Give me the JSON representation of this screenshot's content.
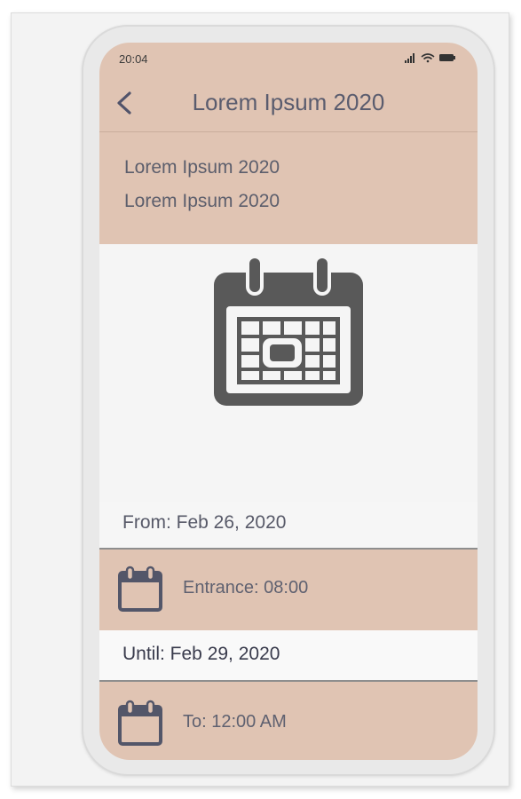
{
  "status_bar": {
    "time": "20:04",
    "icons": [
      "signal-icon",
      "wifi-icon",
      "battery-icon"
    ]
  },
  "header": {
    "back_icon": "chevron-left-icon",
    "title": "Lorem Ipsum 2020"
  },
  "info": {
    "line1": "Lorem Ipsum 2020",
    "line2": "Lorem Ipsum 2020"
  },
  "hero": {
    "icon": "calendar-icon"
  },
  "schedule": {
    "from_label": "From: Feb 26, 2020",
    "entrance_label": "Entrance: 08:00",
    "until_label": "Until: Feb 29, 2020",
    "to_label": "To: 12:00 AM",
    "row_icon": "calendar-icon"
  },
  "colors": {
    "accent_background": "#e0c4b3",
    "icon": "#595959",
    "text": "#5a5c6e"
  }
}
